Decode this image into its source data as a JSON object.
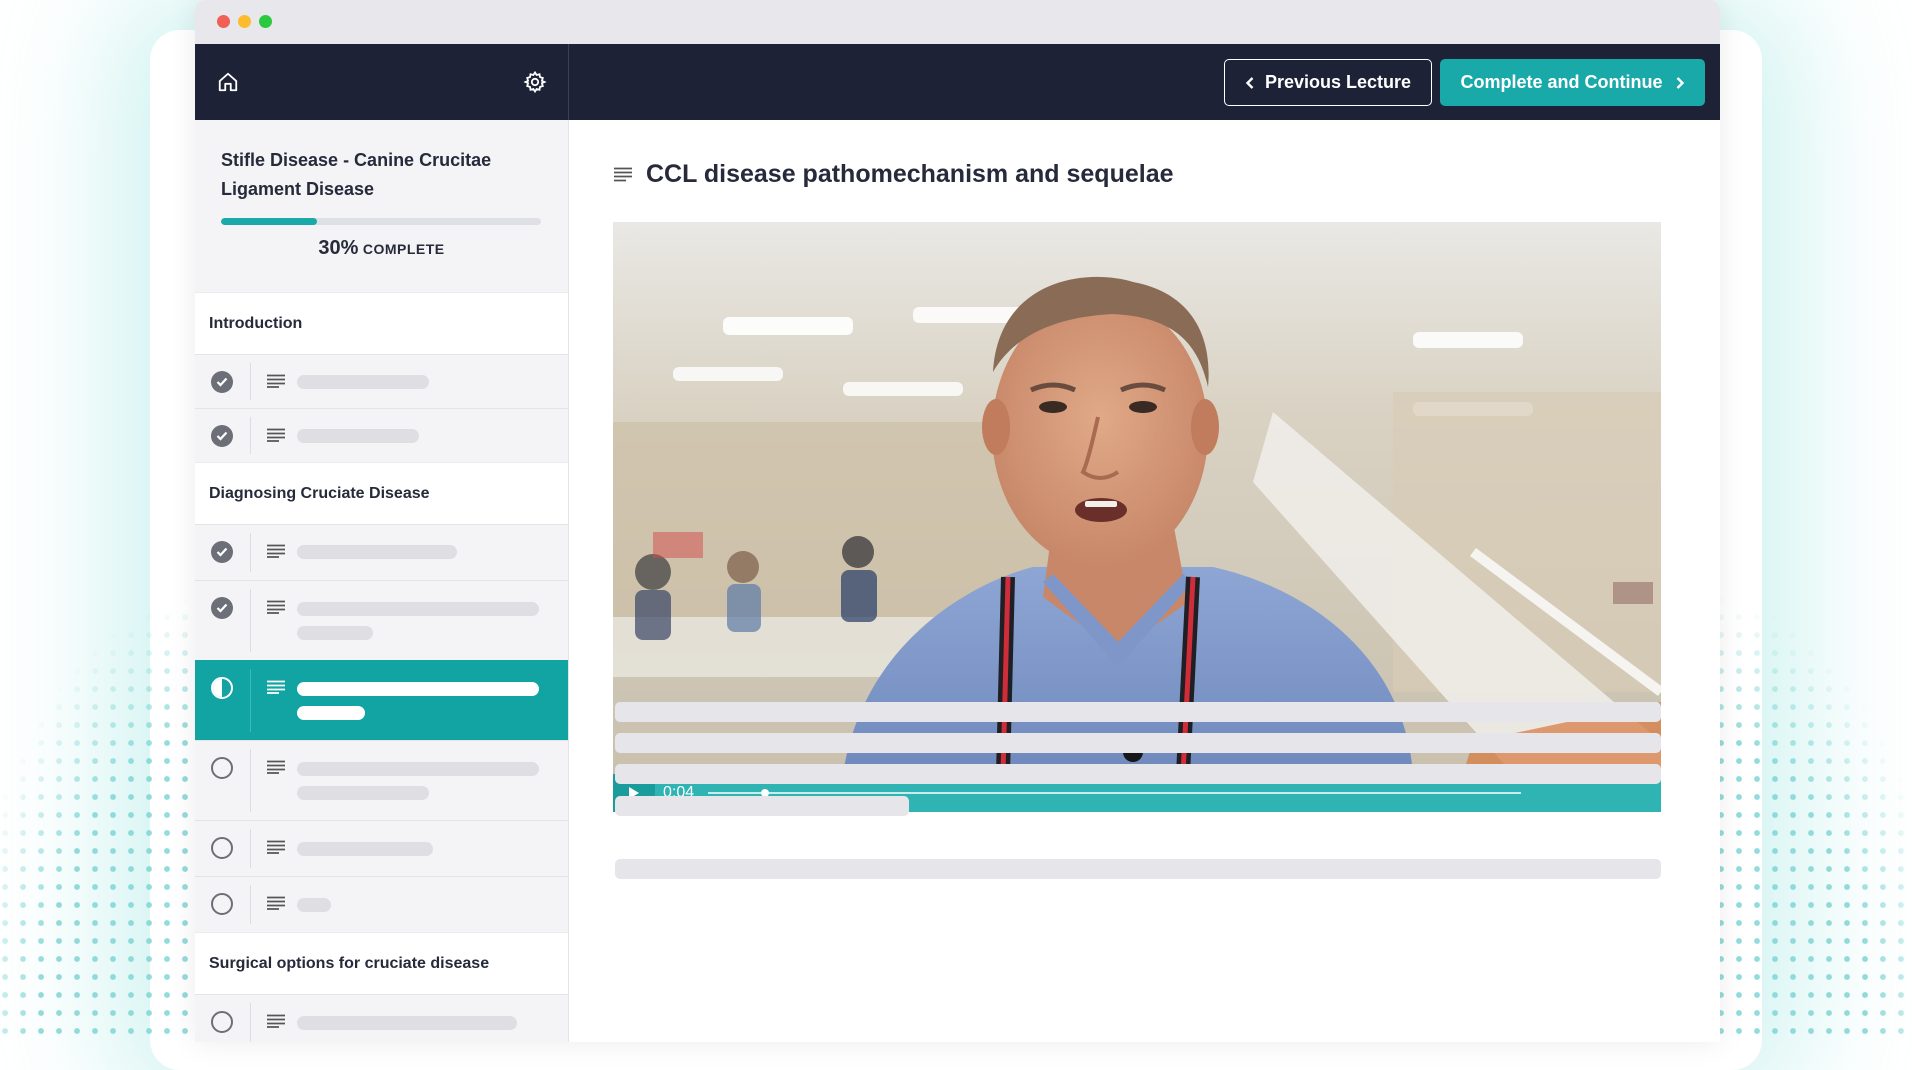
{
  "window": {
    "traffic_lights": [
      "close",
      "minimize",
      "zoom"
    ]
  },
  "topnav": {
    "home_icon": "home-icon",
    "settings_icon": "gear-icon",
    "prev_label": "Previous Lecture",
    "next_label": "Complete and Continue"
  },
  "course": {
    "title": "Stifle Disease - Canine Crucitae Ligament Disease",
    "progress_percent": 30,
    "progress_text": "30%",
    "progress_word": "COMPLETE"
  },
  "sections": [
    {
      "title": "Introduction"
    },
    {
      "title": "Diagnosing Cruciate Disease"
    },
    {
      "title": "Surgical options for cruciate disease"
    }
  ],
  "lessons": [
    {
      "status": "complete"
    },
    {
      "status": "complete"
    },
    {
      "status": "complete"
    },
    {
      "status": "complete"
    },
    {
      "status": "in-progress"
    },
    {
      "status": "not-started"
    },
    {
      "status": "not-started"
    },
    {
      "status": "not-started"
    },
    {
      "status": "not-started"
    }
  ],
  "lecture": {
    "title": "CCL disease pathomechanism and sequelae",
    "video": {
      "current_time": "0:04",
      "played_fraction": 0.07
    }
  },
  "colors": {
    "accent": "#1aa9a9",
    "nav_bg": "#1d2236",
    "sidebar_bg": "#f4f4f6",
    "placeholder": "#e6e6ea"
  }
}
